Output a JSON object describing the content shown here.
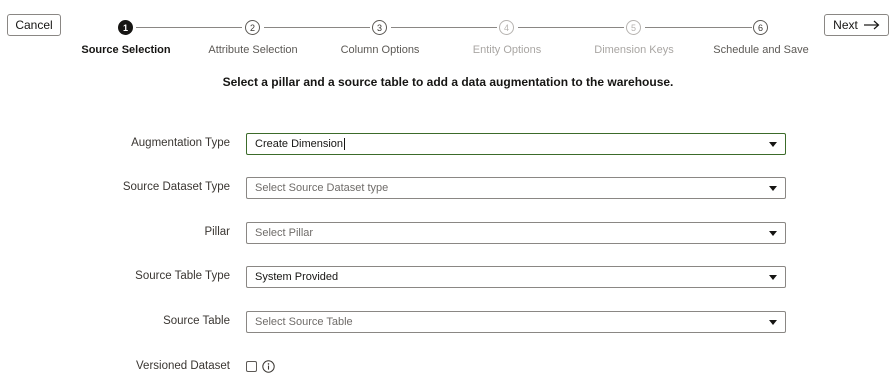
{
  "toolbar": {
    "cancel_label": "Cancel",
    "next_label": "Next"
  },
  "train": {
    "steps": [
      {
        "number": "1",
        "label": "Source Selection",
        "state": "current"
      },
      {
        "number": "2",
        "label": "Attribute Selection",
        "state": "visited"
      },
      {
        "number": "3",
        "label": "Column Options",
        "state": "visited"
      },
      {
        "number": "4",
        "label": "Entity Options",
        "state": "disabled"
      },
      {
        "number": "5",
        "label": "Dimension Keys",
        "state": "disabled"
      },
      {
        "number": "6",
        "label": "Schedule and Save",
        "state": "visited"
      }
    ]
  },
  "instruction": "Select a pillar and a source table to add a data augmentation to the warehouse.",
  "form": {
    "augmentation_type": {
      "label": "Augmentation Type",
      "value": "Create Dimension"
    },
    "source_dataset_type": {
      "label": "Source Dataset Type",
      "placeholder": "Select Source Dataset type"
    },
    "pillar": {
      "label": "Pillar",
      "placeholder": "Select Pillar"
    },
    "source_table_type": {
      "label": "Source Table Type",
      "value": "System Provided"
    },
    "source_table": {
      "label": "Source Table",
      "placeholder": "Select Source Table"
    },
    "versioned_dataset": {
      "label": "Versioned Dataset",
      "checked": false
    }
  },
  "colors": {
    "text": "#161513",
    "border": "#8a8784",
    "focus_border": "#3c6b2a",
    "disabled": "#a9a6a3"
  },
  "icons": {
    "next": "arrow-right-icon",
    "info": "info-icon",
    "dropdown": "chevron-down-icon"
  }
}
